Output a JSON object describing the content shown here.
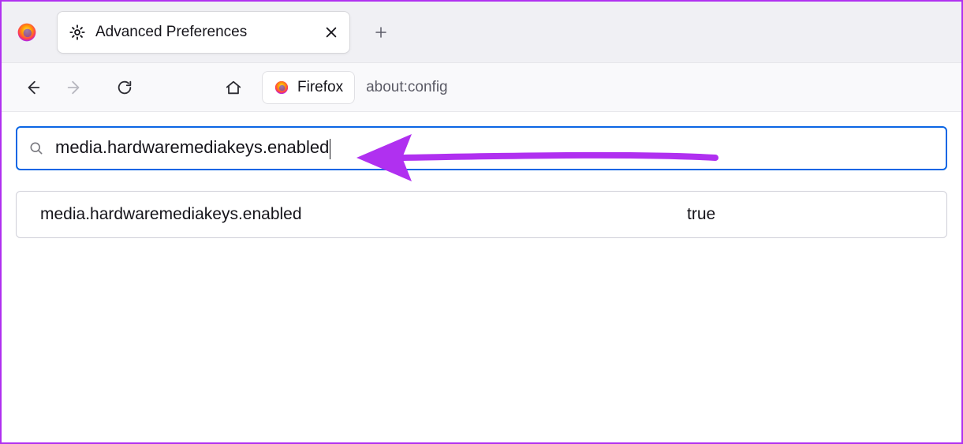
{
  "app": {
    "name": "Firefox"
  },
  "tab": {
    "title": "Advanced Preferences"
  },
  "address_bar": {
    "identity_label": "Firefox",
    "url": "about:config"
  },
  "search": {
    "query": "media.hardwaremediakeys.enabled"
  },
  "result": {
    "name": "media.hardwaremediakeys.enabled",
    "value": "true"
  },
  "colors": {
    "accent": "#0b66e4",
    "annotation": "#b030f0"
  }
}
